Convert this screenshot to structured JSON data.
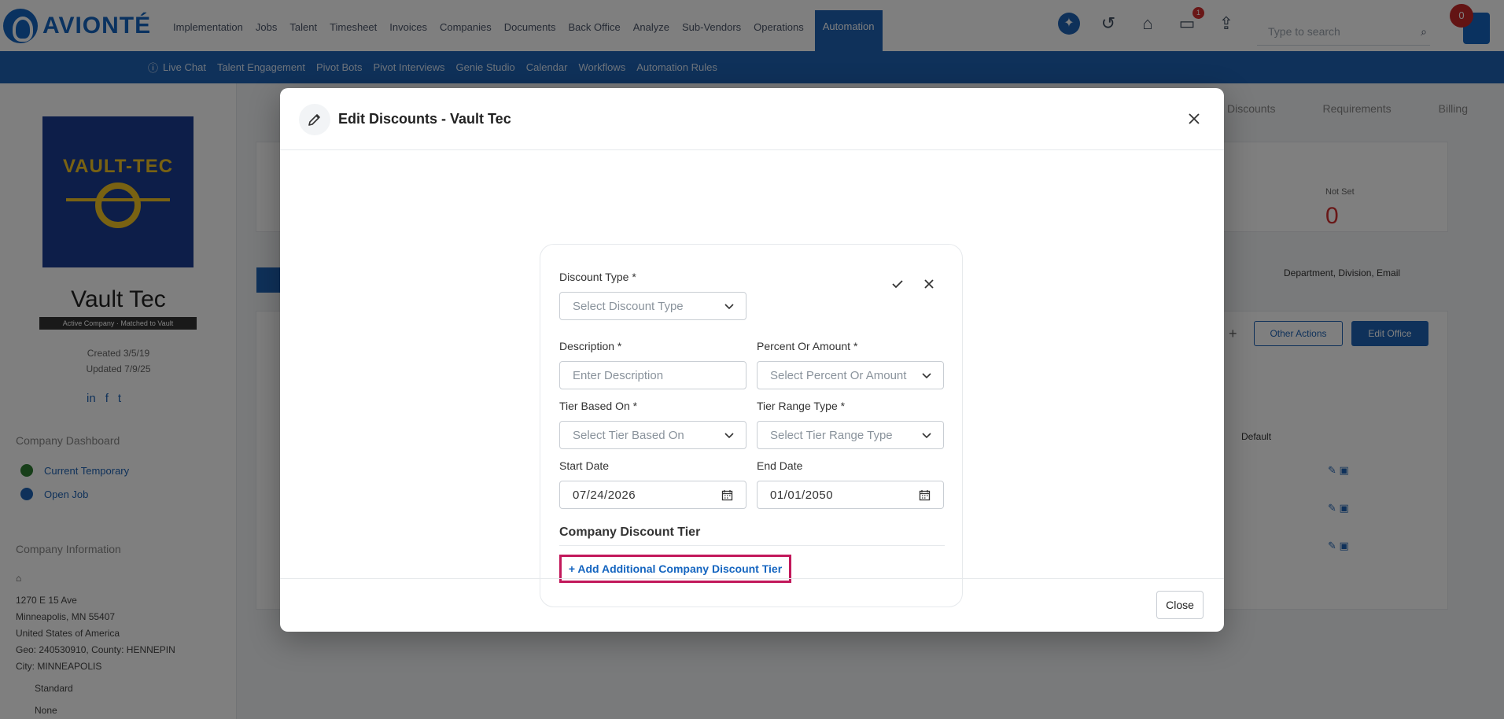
{
  "app": {
    "logo_text": "AVIONTÉ"
  },
  "topnav": {
    "menu": [
      "Implementation",
      "Jobs",
      "Talent",
      "Timesheet",
      "Invoices",
      "Companies",
      "Documents",
      "Back Office",
      "Analyze",
      "Sub-Vendors",
      "Operations",
      "Automation"
    ],
    "active": "Automation",
    "message_badge": "1",
    "user_badge": "0",
    "search_placeholder": "Type to search"
  },
  "subnav": {
    "items": [
      "Live Chat",
      "Talent Engagement",
      "Pivot Bots",
      "Pivot Interviews",
      "Genie Studio",
      "Calendar",
      "Workflows",
      "Automation Rules"
    ]
  },
  "leftpanel": {
    "logo_text": "VAULT-TEC",
    "company_name": "Vault Tec",
    "tag": "Active Company · Matched to Vault",
    "created": "Created 3/5/19",
    "updated": "Updated 7/9/25",
    "dashboard_title": "Company Dashboard",
    "dashboard_links": [
      "Current Temporary",
      "Open Job"
    ],
    "info_title": "Company Information",
    "address": [
      "1270 E 15 Ave",
      "Minneapolis, MN 55407",
      "United States of America",
      "Geo: 240530910, County: HENNEPIN",
      "City: MINNEAPOLIS"
    ],
    "extra": [
      "Standard",
      "None"
    ]
  },
  "background": {
    "tabs": [
      "Discounts",
      "Requirements",
      "Billing"
    ],
    "not_set_label": "Not Set",
    "not_set_value": "0",
    "sort_label": "Department, Division, Email",
    "other_actions": "Other Actions",
    "edit_office": "Edit Office",
    "default_col": "Default"
  },
  "modal": {
    "title": "Edit Discounts - Vault Tec",
    "discount_type": {
      "label": "Discount Type *",
      "placeholder": "Select Discount Type"
    },
    "description": {
      "label": "Description *",
      "placeholder": "Enter Description"
    },
    "percent_or_amount": {
      "label": "Percent Or Amount *",
      "placeholder": "Select Percent Or Amount"
    },
    "tier_based_on": {
      "label": "Tier Based On *",
      "placeholder": "Select Tier Based On"
    },
    "tier_range_type": {
      "label": "Tier Range Type *",
      "placeholder": "Select Tier Range Type"
    },
    "start_date": {
      "label": "Start Date",
      "value": "07/24/2026"
    },
    "end_date": {
      "label": "End Date",
      "value": "01/01/2050"
    },
    "tier_section_title": "Company Discount Tier",
    "add_tier_button": "+ Add Additional Company Discount Tier",
    "close_button": "Close"
  },
  "colors": {
    "brand": "#1e63b5",
    "highlight": "#c2185b",
    "danger": "#d32f2f"
  }
}
